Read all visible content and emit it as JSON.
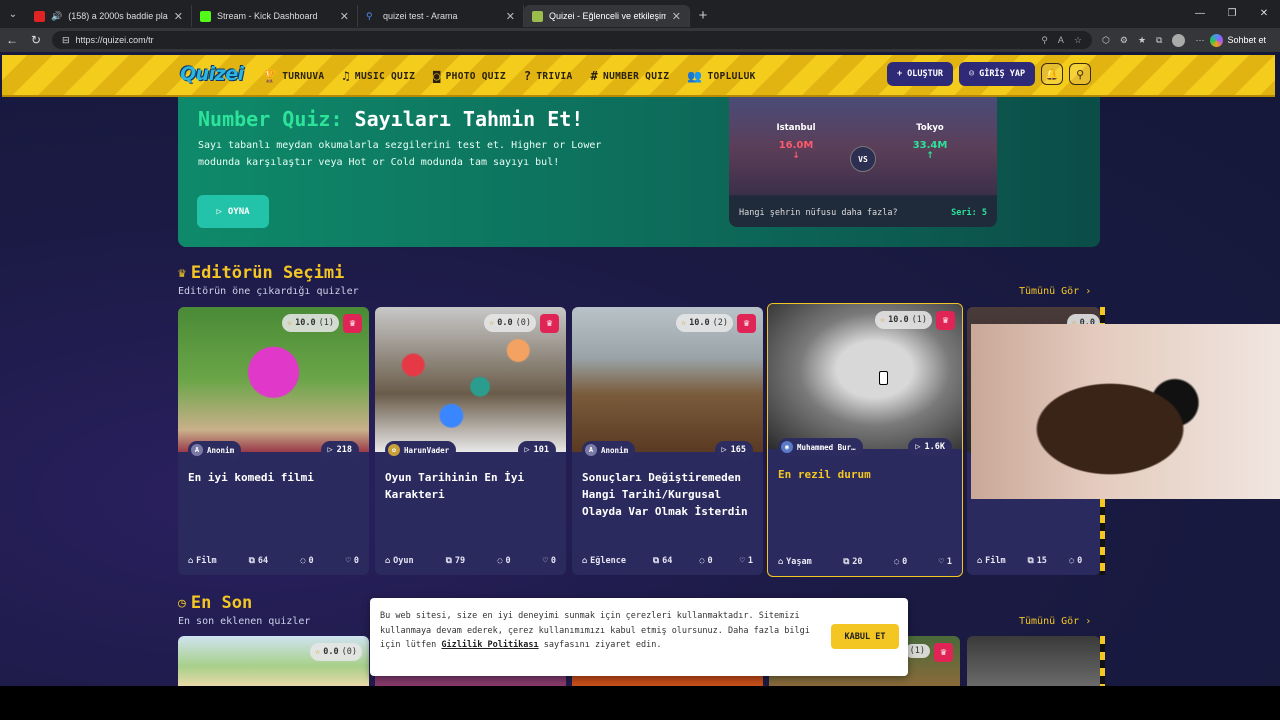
{
  "browser": {
    "tabs": [
      {
        "title": "(158) a 2000s baddie playlist",
        "color": "#e02424"
      },
      {
        "title": "Stream - Kick Dashboard",
        "color": "#53fc18"
      },
      {
        "title": "quizei test - Arama",
        "color": "#4f8ef7"
      },
      {
        "title": "Quizei - Eğlenceli ve etkileşimli qu",
        "color": "#9bbd4b"
      }
    ],
    "url": "https://quizei.com/tr",
    "copilot_label": "Sohbet et"
  },
  "site": {
    "logo": "Quizei",
    "menu": [
      "TURNUVA",
      "MUSIC QUIZ",
      "PHOTO QUIZ",
      "TRIVIA",
      "NUMBER QUIZ",
      "TOPLULUK"
    ],
    "create_label": "OLUŞTUR",
    "login_label": "GİRİŞ YAP"
  },
  "hero": {
    "title_accent": "Number Quiz:",
    "title_main": "Sayıları Tahmin Et!",
    "description": "Sayı tabanlı meydan okumalarla sezgilerini test et. Higher or Lower modunda karşılaştır veya Hot or Cold modunda tam sayıyı bul!",
    "play_label": "OYNA",
    "compare": {
      "left_city": "Istanbul",
      "left_value": "16.0M",
      "right_city": "Tokyo",
      "right_value": "33.4M",
      "vs": "VS",
      "question": "Hangi şehrin nüfusu daha fazla?",
      "streak": "Seri: 5"
    }
  },
  "editors": {
    "title": "Editörün Seçimi",
    "subtitle": "Editörün öne çıkardığı quizler",
    "see_all": "Tümünü Gör ›",
    "cards": [
      {
        "rating": "10.0",
        "rating_count": "(1)",
        "author": "Anonim",
        "views": "218",
        "title": "En iyi komedi filmi",
        "category": "Film",
        "questions": "64",
        "comments": "0",
        "likes": "0"
      },
      {
        "rating": "0.0",
        "rating_count": "(0)",
        "author": "HarunVader",
        "views": "101",
        "title": "Oyun Tarihinin En İyi Karakteri",
        "category": "Oyun",
        "questions": "79",
        "comments": "0",
        "likes": "0"
      },
      {
        "rating": "10.0",
        "rating_count": "(2)",
        "author": "Anonim",
        "views": "165",
        "title": "Sonuçları Değiştiremeden Hangi Tarihi/Kurgusal Olayda Var Olmak İsterdin",
        "category": "Eğlence",
        "questions": "64",
        "comments": "0",
        "likes": "1"
      },
      {
        "rating": "10.0",
        "rating_count": "(1)",
        "author": "Muhammed Bur…",
        "views": "1.6K",
        "title": "En rezil durum",
        "category": "Yaşam",
        "questions": "20",
        "comments": "0",
        "likes": "1"
      },
      {
        "rating": "0.0",
        "rating_count": "",
        "author": "",
        "views": "",
        "title": "",
        "category": "Film",
        "questions": "15",
        "comments": "",
        "likes": "0"
      }
    ]
  },
  "latest": {
    "title": "En Son",
    "subtitle": "En son eklenen quizler",
    "see_all": "Tümünü Gör ›",
    "first_rating": "0.0",
    "first_rating_count": "(0)",
    "fourth_rating_count": "(1)"
  },
  "cookie": {
    "text_before": "Bu web sitesi, size en iyi deneyimi sunmak için çerezleri kullanmaktadır. Sitemizi kullanmaya devam ederek, çerez kullanımımızı kabul etmiş olursunuz. Daha fazla bilgi için lütfen ",
    "link": "Gizlilik Politikası",
    "text_after": " sayfasını ziyaret edin.",
    "accept": "KABUL ET"
  }
}
